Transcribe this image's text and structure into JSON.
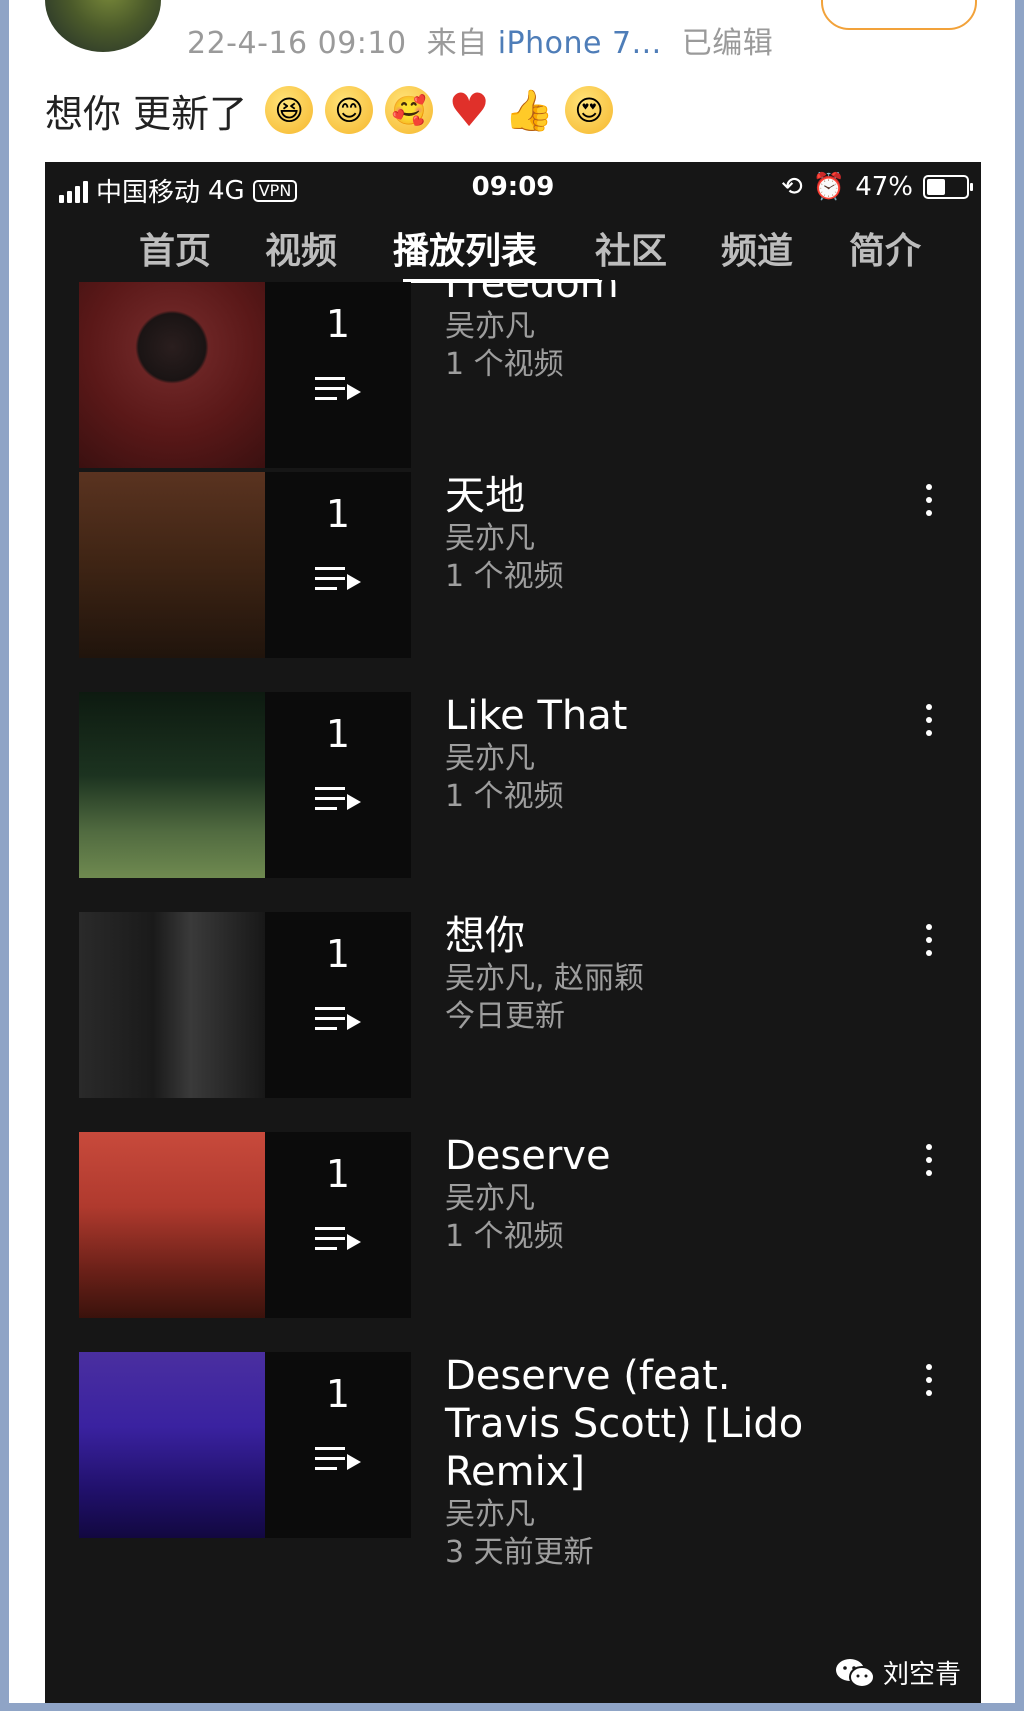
{
  "post": {
    "meta_time": "22-4-16 09:10",
    "meta_from": "来自",
    "meta_source": "iPhone 7...",
    "meta_edited": "已编辑",
    "text": "想你 更新了",
    "emojis": [
      "laughing-face-icon",
      "smiling-face-icon",
      "hugging-face-icon",
      "heart-icon",
      "thumbs-up-icon",
      "love-face-icon"
    ]
  },
  "phone": {
    "status": {
      "carrier": "中国移动",
      "network": "4G",
      "vpn": "VPN",
      "time": "09:09",
      "battery": "47%",
      "battery_level": 0.47
    },
    "tabs": [
      "首页",
      "视频",
      "播放列表",
      "社区",
      "频道",
      "简介"
    ],
    "active_tab": "播放列表",
    "playlists": [
      {
        "title": "Freedom",
        "artist": "吴亦凡",
        "meta": "1 个视频",
        "count": "1"
      },
      {
        "title": "天地",
        "artist": "吴亦凡",
        "meta": "1 个视频",
        "count": "1"
      },
      {
        "title": "Like That",
        "artist": "吴亦凡",
        "meta": "1 个视频",
        "count": "1"
      },
      {
        "title": "想你",
        "artist": "吴亦凡, 赵丽颖",
        "meta": "今日更新",
        "count": "1"
      },
      {
        "title": "Deserve",
        "artist": "吴亦凡",
        "meta": "1 个视频",
        "count": "1"
      },
      {
        "title": "Deserve (feat. Travis Scott) [Lido Remix]",
        "artist": "吴亦凡",
        "meta": "3 天前更新",
        "count": "1"
      }
    ]
  },
  "watermark": {
    "name": "刘空青"
  },
  "colors": {
    "link": "#4e7db8",
    "meta_gray": "#9a9a9a",
    "phone_bg": "#161616",
    "frame_border": "#8fa4c6"
  }
}
